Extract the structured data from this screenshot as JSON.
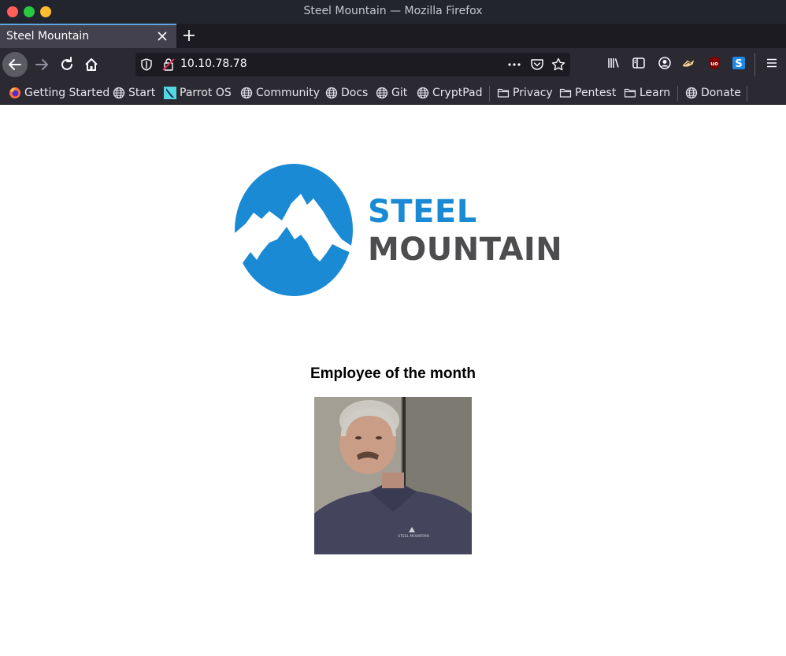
{
  "window": {
    "title": "Steel Mountain — Mozilla Firefox"
  },
  "tabs": [
    {
      "label": "Steel Mountain"
    }
  ],
  "navbar": {
    "url": "10.10.78.78"
  },
  "bookmarks": [
    {
      "label": "Getting Started",
      "icon": "firefox-icon"
    },
    {
      "label": "Start",
      "icon": "globe-icon"
    },
    {
      "label": "Parrot OS",
      "icon": "parrot-icon"
    },
    {
      "label": "Community",
      "icon": "globe-icon"
    },
    {
      "label": "Docs",
      "icon": "globe-icon"
    },
    {
      "label": "Git",
      "icon": "globe-icon"
    },
    {
      "label": "CryptPad",
      "icon": "globe-icon"
    },
    {
      "label": "Privacy",
      "icon": "folder-icon"
    },
    {
      "label": "Pentest",
      "icon": "folder-icon"
    },
    {
      "label": "Learn",
      "icon": "folder-icon"
    },
    {
      "label": "Donate",
      "icon": "globe-icon"
    }
  ],
  "page": {
    "logo_line1": "STEEL",
    "logo_line2": "MOUNTAIN",
    "heading": "Employee of the month",
    "photo_shirt_text": "STEEL MOUNTAIN"
  },
  "colors": {
    "brand_blue": "#1a8ad4",
    "brand_gray": "#4d4d4f",
    "chrome_dark": "#2b2a33",
    "titlebar": "#23252e"
  }
}
